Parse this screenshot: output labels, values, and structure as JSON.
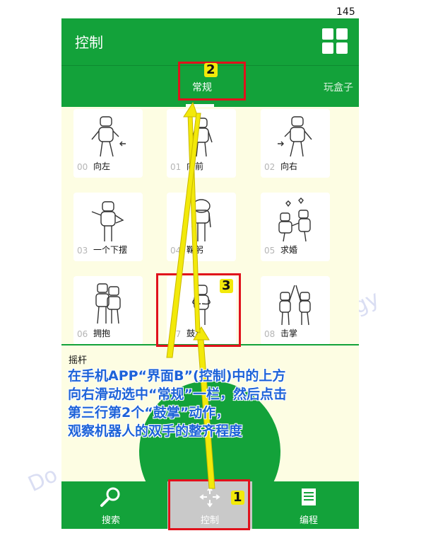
{
  "page_number": "145",
  "header": {
    "title": "控制"
  },
  "tabs": [
    {
      "label": "常规"
    },
    {
      "label": "玩盒子"
    }
  ],
  "actions": [
    {
      "num": "00",
      "name": "向左"
    },
    {
      "num": "01",
      "name": "向前"
    },
    {
      "num": "02",
      "name": "向右"
    },
    {
      "num": "03",
      "name": "一个下摆"
    },
    {
      "num": "04",
      "name": "鞠躬"
    },
    {
      "num": "05",
      "name": "求婚"
    },
    {
      "num": "06",
      "name": "拥抱"
    },
    {
      "num": "07",
      "name": "鼓掌"
    },
    {
      "num": "08",
      "name": "击掌"
    }
  ],
  "joystick": {
    "label": "摇杆"
  },
  "bottom_nav": [
    {
      "label": "搜索"
    },
    {
      "label": "控制"
    },
    {
      "label": "编程"
    }
  ],
  "markers": {
    "m1": "1",
    "m2": "2",
    "m3": "3"
  },
  "instruction": {
    "line1": "在手机APP“界面B”(控制)中的上方",
    "line2": "向右滑动选中“常规”一栏，然后点击",
    "line3": "第三行第2个“鼓掌”动作，",
    "line4": "观察机器人的双手的整齐程度"
  },
  "colors": {
    "green": "#13a23a",
    "red": "#e0121c",
    "yellow": "#f2e90a",
    "blue_text": "#1e63d8"
  }
}
